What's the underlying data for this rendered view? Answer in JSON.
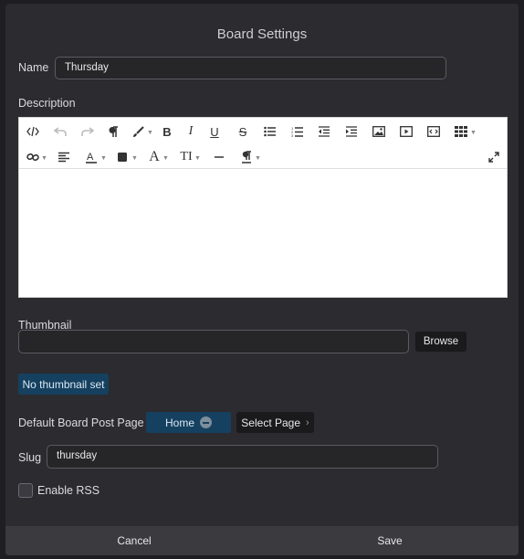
{
  "dialog": {
    "title": "Board Settings"
  },
  "name": {
    "label": "Name",
    "value": "Thursday"
  },
  "description": {
    "label": "Description"
  },
  "thumbnail": {
    "label": "Thumbnail",
    "value": "",
    "browse_label": "Browse",
    "status": "No thumbnail set"
  },
  "post_page": {
    "label": "Default Board Post Page",
    "selected": "Home",
    "select_label": "Select Page"
  },
  "slug": {
    "label": "Slug",
    "value": "thursday"
  },
  "rss": {
    "label": "Enable RSS",
    "checked": false
  },
  "footer": {
    "cancel_label": "Cancel",
    "save_label": "Save"
  },
  "toolbar": {
    "row1": [
      "code-view-icon",
      "undo-icon",
      "redo-icon",
      "paragraph-icon",
      "paint-brush-icon",
      "bold-icon",
      "italic-icon",
      "underline-icon",
      "strikethrough-icon",
      "bullet-list-icon",
      "numbered-list-icon",
      "outdent-icon",
      "indent-icon",
      "insert-image-icon",
      "insert-video-icon",
      "embed-code-icon",
      "table-icon"
    ],
    "row2": [
      "link-icon",
      "align-left-icon",
      "text-color-icon",
      "background-color-icon",
      "font-size-icon",
      "line-height-icon",
      "horizontal-rule-icon",
      "paragraph-style-icon",
      "fullscreen-icon"
    ]
  },
  "colors": {
    "accent": "#16405f",
    "background": "#2b2b30",
    "footer": "#3a3a3f"
  }
}
